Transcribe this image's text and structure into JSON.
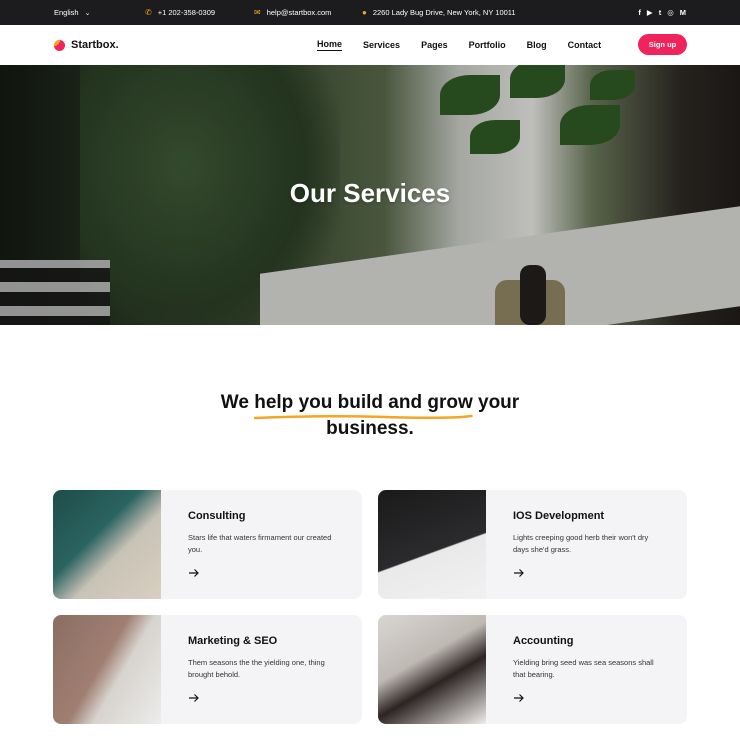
{
  "topbar": {
    "language": "English",
    "phone": "+1 202-358-0309",
    "email": "help@startbox.com",
    "address": "2260 Lady Bug Drive, New York, NY 10011",
    "social": [
      "f",
      "▶",
      "t",
      "◎",
      "M"
    ]
  },
  "navbar": {
    "brand": "Startbox.",
    "links": [
      "Home",
      "Services",
      "Pages",
      "Portfolio",
      "Blog",
      "Contact"
    ],
    "cta": "Sign up"
  },
  "hero": {
    "title": "Our Services"
  },
  "section": {
    "heading_pre": "We ",
    "heading_highlight": "help you build and grow",
    "heading_post": " your",
    "heading_line2": "business."
  },
  "services": [
    {
      "title": "Consulting",
      "description": "Stars life that waters firmament our created you."
    },
    {
      "title": "IOS Development",
      "description": "Lights creeping good herb their won't dry days she'd grass."
    },
    {
      "title": "Marketing & SEO",
      "description": "Them seasons the the yielding one, thing brought behold."
    },
    {
      "title": "Accounting",
      "description": "Yielding bring seed was sea seasons shall that bearing."
    }
  ],
  "colors": {
    "accent": "#f0245b",
    "highlight": "#f5a524",
    "topbar_bg": "#1c1c1e",
    "card_bg": "#f4f4f6"
  }
}
